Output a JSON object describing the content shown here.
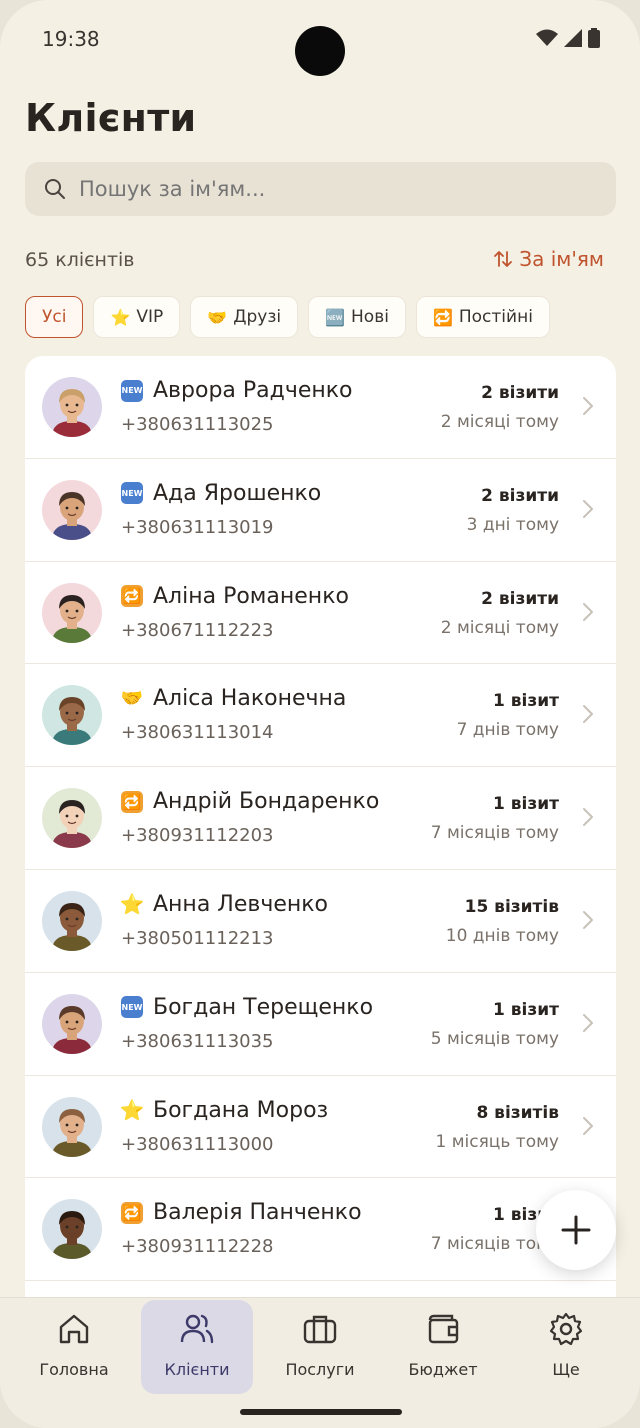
{
  "status_bar": {
    "time": "19:38"
  },
  "header": {
    "title": "Клієнти"
  },
  "search": {
    "placeholder": "Пошук за ім'ям..."
  },
  "summary": {
    "count": "65 клієнтів",
    "sort_label": "За ім'ям"
  },
  "filters": [
    {
      "label": "Усі",
      "emoji": "",
      "active": true
    },
    {
      "label": "VIP",
      "emoji": "⭐"
    },
    {
      "label": "Друзі",
      "emoji": "🤝"
    },
    {
      "label": "Нові",
      "emoji": "🆕"
    },
    {
      "label": "Постійні",
      "emoji": "🔁"
    }
  ],
  "clients": [
    {
      "name": "Аврора Радченко",
      "phone": "+380631113025",
      "visits": "2 візити",
      "last": "2 місяці тому",
      "tag": "new",
      "avatar_bg": "#ddd6ea",
      "skin": "#e8b890",
      "hair": "#c9a06a",
      "shirt": "#9a2c3a"
    },
    {
      "name": "Ада Ярошенко",
      "phone": "+380631113019",
      "visits": "2 візити",
      "last": "3 дні тому",
      "tag": "new",
      "avatar_bg": "#f3d8dc",
      "skin": "#d9a47a",
      "hair": "#4a3428",
      "shirt": "#4a4f8a"
    },
    {
      "name": "Аліна Романенко",
      "phone": "+380671112223",
      "visits": "2 візити",
      "last": "2 місяці тому",
      "tag": "repeat",
      "avatar_bg": "#f3d8dc",
      "skin": "#e2b08a",
      "hair": "#2a2220",
      "shirt": "#5a7a3a"
    },
    {
      "name": "Аліса Наконечна",
      "phone": "+380631113014",
      "visits": "1 візит",
      "last": "7 днів тому",
      "tag": "friend",
      "avatar_bg": "#cfe6e2",
      "skin": "#9a6a48",
      "hair": "#6a4428",
      "shirt": "#3a7a7a"
    },
    {
      "name": "Андрій Бондаренко",
      "phone": "+380931112203",
      "visits": "1 візит",
      "last": "7 місяців тому",
      "tag": "repeat",
      "avatar_bg": "#e2ead6",
      "skin": "#f2d2b8",
      "hair": "#2a2220",
      "shirt": "#8a3a4a"
    },
    {
      "name": "Анна Левченко",
      "phone": "+380501112213",
      "visits": "15 візитів",
      "last": "10 днів тому",
      "tag": "vip",
      "avatar_bg": "#d8e2ea",
      "skin": "#8a5a3a",
      "hair": "#3a2418",
      "shirt": "#6a5a2a"
    },
    {
      "name": "Богдан Терещенко",
      "phone": "+380631113035",
      "visits": "1 візит",
      "last": "5 місяців тому",
      "tag": "new",
      "avatar_bg": "#ddd6ea",
      "skin": "#d9a47a",
      "hair": "#5a3a28",
      "shirt": "#8a2a3a"
    },
    {
      "name": "Богдана Мороз",
      "phone": "+380631113000",
      "visits": "8 візитів",
      "last": "1 місяць тому",
      "tag": "vip",
      "avatar_bg": "#d8e2ea",
      "skin": "#e2b08a",
      "hair": "#8a6040",
      "shirt": "#6a5a2a"
    },
    {
      "name": "Валерія Панченко",
      "phone": "+380931112228",
      "visits": "1 візит",
      "last": "7 місяців тому",
      "tag": "repeat",
      "avatar_bg": "#d8e2ea",
      "skin": "#6a4028",
      "hair": "#2a1a10",
      "shirt": "#5a5a2a"
    }
  ],
  "nav": [
    {
      "label": "Головна",
      "icon": "home-icon"
    },
    {
      "label": "Клієнти",
      "icon": "users-icon",
      "active": true
    },
    {
      "label": "Послуги",
      "icon": "briefcase-icon"
    },
    {
      "label": "Бюджет",
      "icon": "wallet-icon"
    },
    {
      "label": "Ще",
      "icon": "gear-icon"
    }
  ],
  "colors": {
    "accent": "#c0542e",
    "background": "#f5f0e4",
    "nav_active": "#dbd9e6"
  }
}
